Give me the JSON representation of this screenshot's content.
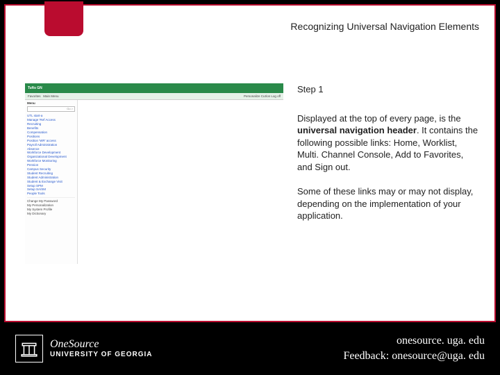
{
  "title": "Recognizing Universal Navigation Elements",
  "step_label": "Step 1",
  "para1_pre": "Displayed at the top of every page, is the ",
  "para1_bold": "universal navigation header",
  "para1_post": ". It contains the following possible links: Home, Worklist, Multi. Channel Console, Add to Favorites, and Sign out.",
  "para2": "Some of these links may or may not display, depending on the implementation of your application.",
  "screenshot": {
    "brand": "Tufts  GN",
    "top_links": {
      "a": "Favorites",
      "b": "Main Menu"
    },
    "right_links": "Personalize  Cut/on  Log off",
    "side_header": "Menu",
    "search_hint": "Go >",
    "items": {
      "i0": "UTL start-a",
      "i1": "Manage 'Ref Access",
      "i2": "Recruiting",
      "i3": "Benefits",
      "i4": "Compensation",
      "i5": "Positions",
      "i6": "Position 'WR' access",
      "i7": "Payroll Administration",
      "i8": "Absence",
      "i9": "Workforce Development",
      "i10": "Organizational Development",
      "i11": "Workforce Monitoring",
      "i12": "Pension",
      "i13": "Campus Security",
      "i14": "Student Recruiting",
      "i15": "Student Administration",
      "i16": "Student & Exchange Visit",
      "i17": "Setup SPM",
      "i18": "Setup SA/SM",
      "i19": "People Tools",
      "i20": "Change My Password",
      "i21": "My Personalization",
      "i22": "My System Profile",
      "i23": "My Dictionary"
    }
  },
  "footer": {
    "onesource": "OneSource",
    "uga": "UNIVERSITY OF GEORGIA",
    "url": "onesource. uga. edu",
    "feedback": "Feedback: onesource@uga. edu"
  }
}
